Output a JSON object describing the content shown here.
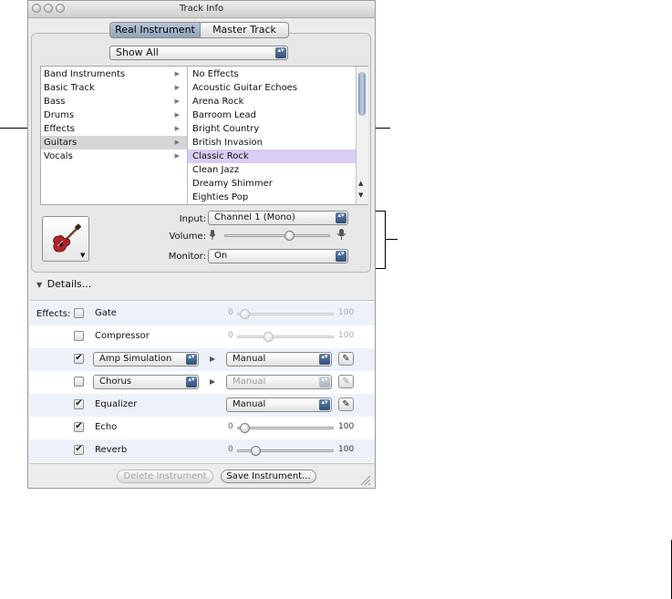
{
  "window": {
    "title": "Track Info"
  },
  "tabs": {
    "real": "Real Instrument",
    "master": "Master Track"
  },
  "category_select": {
    "value": "Show All"
  },
  "categories": [
    {
      "label": "Band Instruments",
      "selected": false
    },
    {
      "label": "Basic Track",
      "selected": false
    },
    {
      "label": "Bass",
      "selected": false
    },
    {
      "label": "Drums",
      "selected": false
    },
    {
      "label": "Effects",
      "selected": false
    },
    {
      "label": "Guitars",
      "selected": true
    },
    {
      "label": "Vocals",
      "selected": false
    }
  ],
  "presets": [
    {
      "label": "No Effects",
      "selected": false
    },
    {
      "label": "Acoustic Guitar Echoes",
      "selected": false
    },
    {
      "label": "Arena Rock",
      "selected": false
    },
    {
      "label": "Barroom Lead",
      "selected": false
    },
    {
      "label": "Bright Country",
      "selected": false
    },
    {
      "label": "British Invasion",
      "selected": false
    },
    {
      "label": "Classic Rock",
      "selected": true
    },
    {
      "label": "Clean Jazz",
      "selected": false
    },
    {
      "label": "Dreamy Shimmer",
      "selected": false
    },
    {
      "label": "Eighties Pop",
      "selected": false
    }
  ],
  "input": {
    "label": "Input:",
    "value": "Channel 1 (Mono)"
  },
  "volume": {
    "label": "Volume:",
    "level": 0.63
  },
  "monitor": {
    "label": "Monitor:",
    "value": "On"
  },
  "details": {
    "label": "Details..."
  },
  "effects": {
    "label": "Effects:",
    "slider_min": "0",
    "slider_max": "100",
    "rows": [
      {
        "name": "Gate",
        "checked": false,
        "kind": "slider",
        "value": 0.03,
        "disabled": true
      },
      {
        "name": "Compressor",
        "checked": false,
        "kind": "slider",
        "value": 0.3,
        "disabled": true
      },
      {
        "name": "Amp Simulation",
        "checked": true,
        "kind": "popup",
        "preset": "Manual",
        "disabled": false
      },
      {
        "name": "Chorus",
        "checked": false,
        "kind": "popup",
        "preset": "Manual",
        "disabled": true
      },
      {
        "name": "Equalizer",
        "checked": true,
        "kind": "eq",
        "preset": "Manual",
        "disabled": false
      },
      {
        "name": "Echo",
        "checked": true,
        "kind": "slider",
        "value": 0.03,
        "disabled": false
      },
      {
        "name": "Reverb",
        "checked": true,
        "kind": "slider",
        "value": 0.16,
        "disabled": false
      }
    ]
  },
  "buttons": {
    "delete": "Delete Instrument",
    "save": "Save Instrument..."
  },
  "symbols": {
    "check": "✔",
    "pencil": "✎",
    "triangle_right": "▶",
    "triangle_down": "▼",
    "updown": "▴▾"
  },
  "icons": [
    "guitar-icon",
    "microphone-icon",
    "pencil-icon",
    "chevron-updown-icon",
    "disclosure-triangle-icon",
    "resize-grip-icon"
  ],
  "colors": {
    "selection_lilac": "#d9ccf5",
    "selection_gray": "#d6d6d6",
    "accent_blue": "#3c5f8f"
  }
}
